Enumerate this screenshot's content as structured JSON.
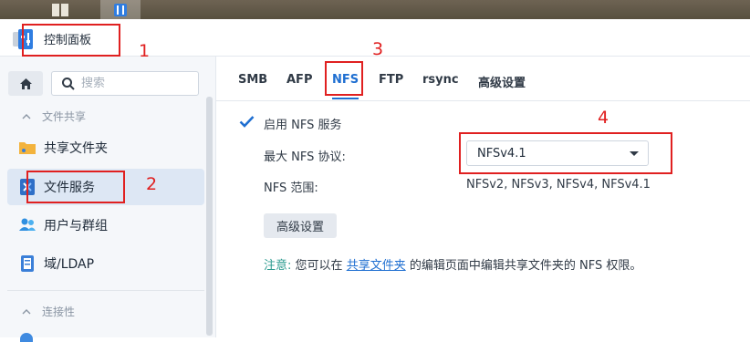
{
  "window": {
    "title": "控制面板"
  },
  "search": {
    "placeholder": "搜索"
  },
  "sidebar": {
    "sections": [
      {
        "label": "文件共享"
      },
      {
        "label": "连接性"
      }
    ],
    "items": [
      {
        "label": "共享文件夹",
        "icon": "folder-share-icon"
      },
      {
        "label": "文件服务",
        "icon": "file-services-icon",
        "active": true
      },
      {
        "label": "用户与群组",
        "icon": "users-icon"
      },
      {
        "label": "域/LDAP",
        "icon": "domain-ldap-icon"
      }
    ]
  },
  "tabs": [
    {
      "label": "SMB"
    },
    {
      "label": "AFP"
    },
    {
      "label": "NFS",
      "active": true
    },
    {
      "label": "FTP"
    },
    {
      "label": "rsync"
    },
    {
      "label": "高级设置"
    }
  ],
  "nfs": {
    "enable_label": "启用 NFS 服务",
    "enabled": true,
    "max_protocol_label": "最大 NFS 协议:",
    "max_protocol_value": "NFSv4.1",
    "range_label": "NFS 范围:",
    "range_value": "NFSv2, NFSv3, NFSv4, NFSv4.1",
    "advanced_button": "高级设置",
    "note_label": "注意:",
    "note_text_1": "您可以在",
    "note_link": "共享文件夹",
    "note_text_2": "的编辑页面中编辑共享文件夹的 NFS 权限。"
  },
  "annotations": [
    "1",
    "2",
    "3",
    "4"
  ],
  "colors": {
    "accent": "#1f6fd1",
    "annotation": "#e02020",
    "note": "#2a9a8e"
  }
}
